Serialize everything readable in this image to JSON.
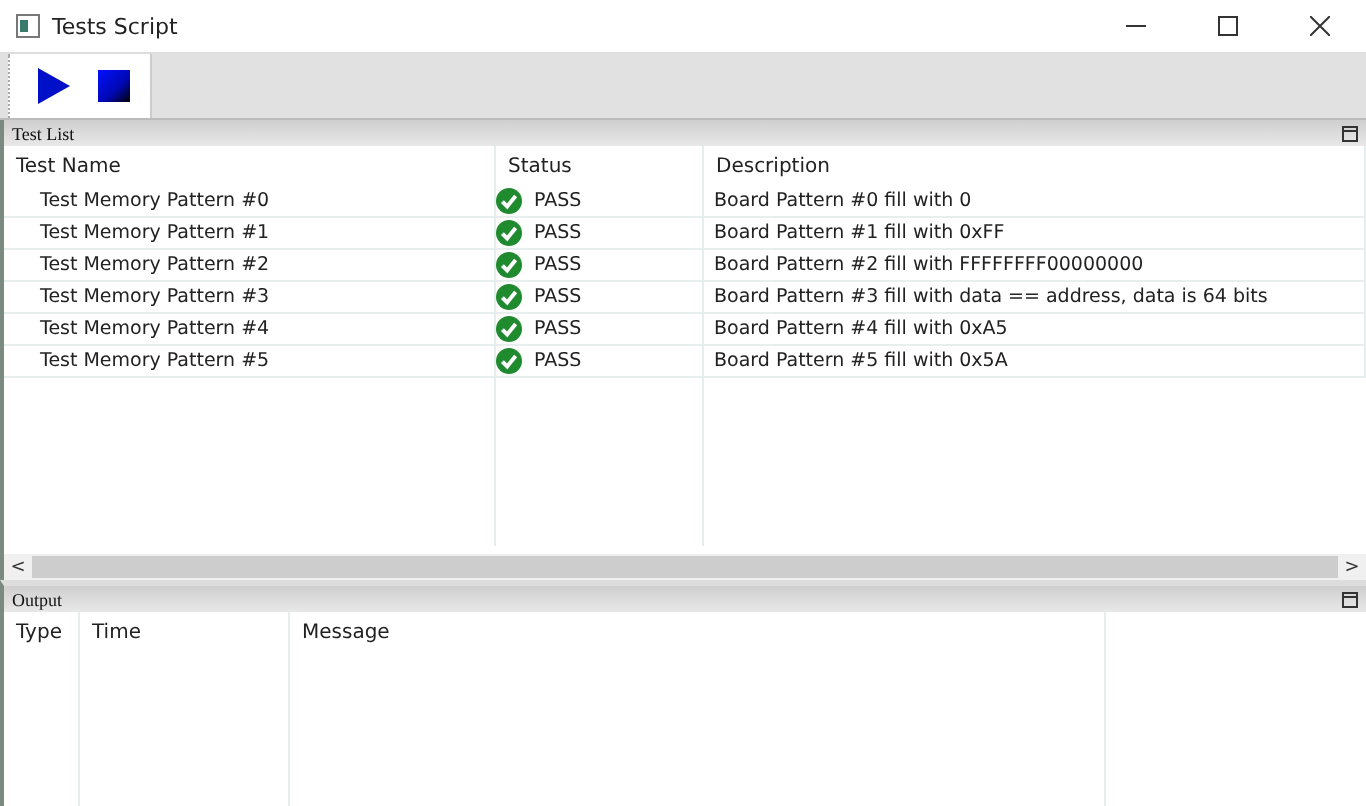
{
  "window": {
    "title": "Tests Script"
  },
  "toolbar": {
    "buttons": [
      {
        "kind": "play"
      },
      {
        "kind": "stop"
      }
    ]
  },
  "test_list": {
    "title": "Test List",
    "columns": [
      "Test Name",
      "Status",
      "Description"
    ],
    "rows": [
      {
        "name": "Test Memory Pattern #0",
        "status": "PASS",
        "description": "Board Pattern #0 fill with 0"
      },
      {
        "name": "Test Memory Pattern #1",
        "status": "PASS",
        "description": "Board Pattern #1 fill with 0xFF"
      },
      {
        "name": "Test Memory Pattern #2",
        "status": "PASS",
        "description": "Board Pattern #2 fill with FFFFFFFF00000000"
      },
      {
        "name": "Test Memory Pattern #3",
        "status": "PASS",
        "description": "Board Pattern #3 fill with data == address, data is 64 bits"
      },
      {
        "name": "Test Memory Pattern #4",
        "status": "PASS",
        "description": "Board Pattern #4 fill with 0xA5"
      },
      {
        "name": "Test Memory Pattern #5",
        "status": "PASS",
        "description": "Board Pattern #5 fill with 0x5A"
      }
    ],
    "scroll_left": "<",
    "scroll_right": ">"
  },
  "output": {
    "title": "Output",
    "columns": [
      "Type",
      "Time",
      "Message"
    ]
  }
}
